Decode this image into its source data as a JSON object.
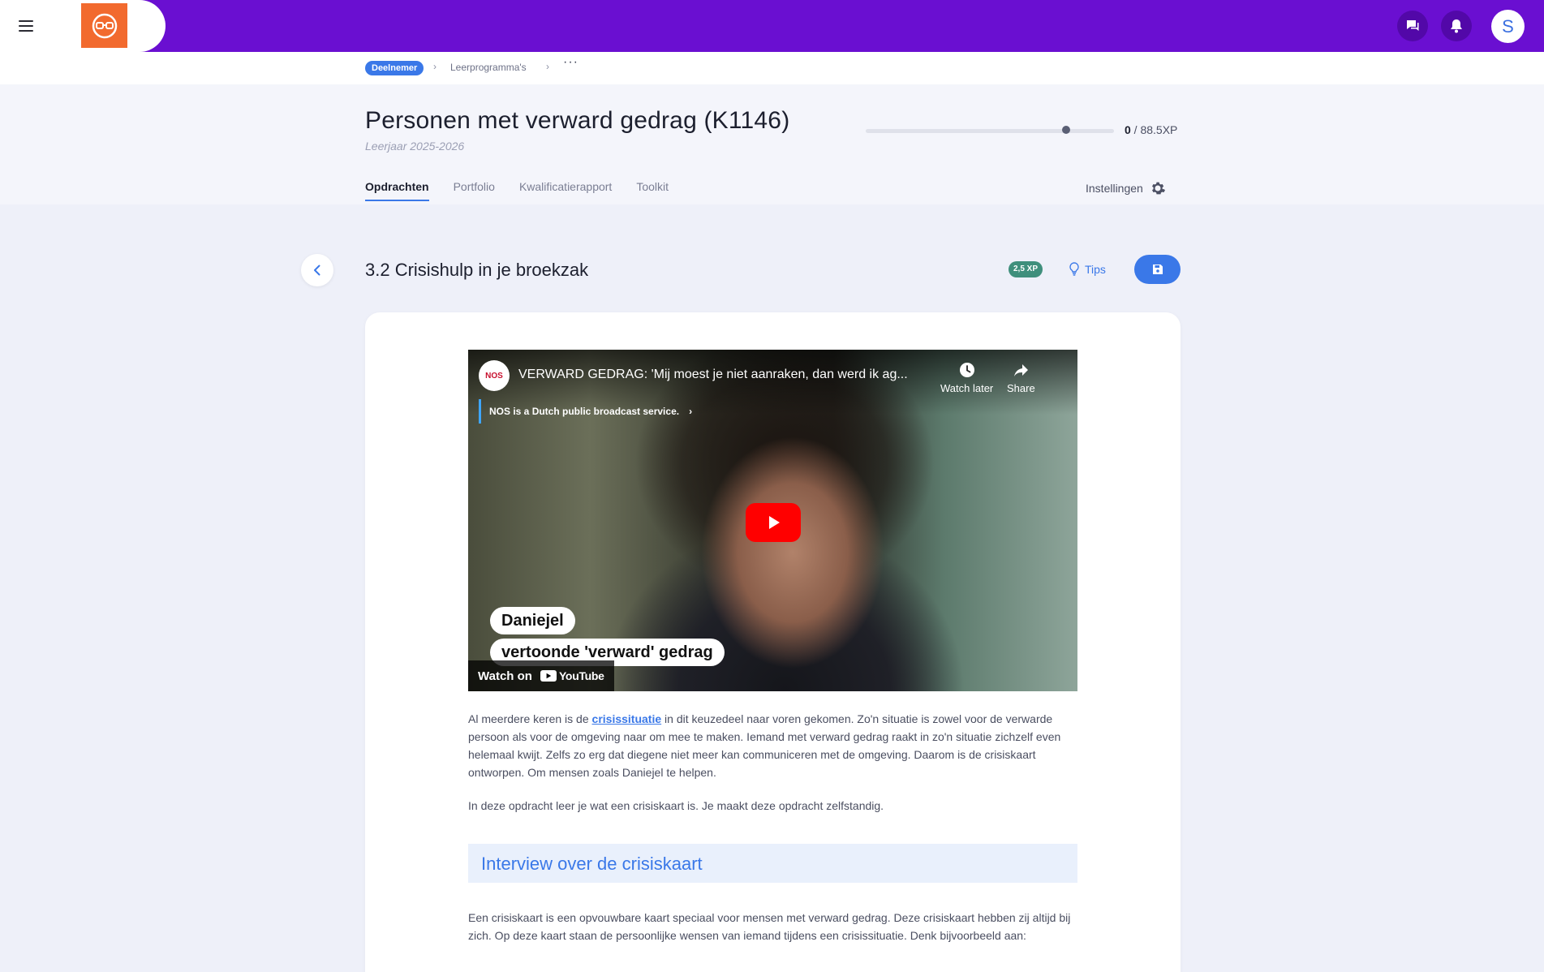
{
  "topbar": {
    "avatar_initial": "S",
    "colors": {
      "bar": "#6a0fd1",
      "logo": "#f26a2e"
    },
    "icons": [
      "menu-icon",
      "chat-icon",
      "bell-icon"
    ]
  },
  "breadcrumb": {
    "badge": "Deelnemer",
    "link": "Leerprogramma's",
    "more": "···"
  },
  "header": {
    "title": "Personen met verward gedrag (K1146)",
    "subtitle": "Leerjaar 2025-2026",
    "xp_current": "0",
    "xp_total": " / 88.5XP",
    "progress_fraction": 0.0
  },
  "tabs": [
    {
      "label": "Opdrachten",
      "active": true
    },
    {
      "label": "Portfolio",
      "active": false
    },
    {
      "label": "Kwalificatierapport",
      "active": false
    },
    {
      "label": "Toolkit",
      "active": false
    }
  ],
  "settings_label": "Instellingen",
  "assignment": {
    "title": "3.2 Crisishulp in je broekzak",
    "xp_badge": "2,5 XP",
    "tips_label": "Tips"
  },
  "video": {
    "channel_logo": "NOS",
    "title": "VERWARD GEDRAG: 'Mij moest je niet aanraken, dan werd ik ag...",
    "note": "NOS is a Dutch public broadcast service.",
    "watch_later": "Watch later",
    "share": "Share",
    "caption_1": "Daniejel",
    "caption_2": "vertoonde 'verward' gedrag",
    "watch_on": "Watch on",
    "youtube": "YouTube"
  },
  "content": {
    "p1_before": "Al meerdere keren is de ",
    "p1_link": "crisissituatie",
    "p1_after": " in dit keuzedeel naar voren gekomen. Zo'n situatie is zowel voor de verwarde persoon als voor de omgeving naar om mee te maken. Iemand met verward gedrag raakt in zo'n situatie zichzelf even helemaal kwijt. Zelfs zo erg dat diegene niet meer kan communiceren met de omgeving. Daarom is de crisiskaart ontworpen. Om mensen zoals Daniejel te helpen.",
    "p2": "In deze opdracht leer je wat een crisiskaart is. Je maakt deze opdracht zelfstandig.",
    "section_title": "Interview over de crisiskaart",
    "p3": "Een crisiskaart is een opvouwbare kaart speciaal voor mensen met verward gedrag. Deze crisiskaart hebben zij altijd bij zich. Op deze kaart staan de persoonlijke wensen van iemand tijdens een crisissituatie. Denk bijvoorbeeld aan:"
  }
}
